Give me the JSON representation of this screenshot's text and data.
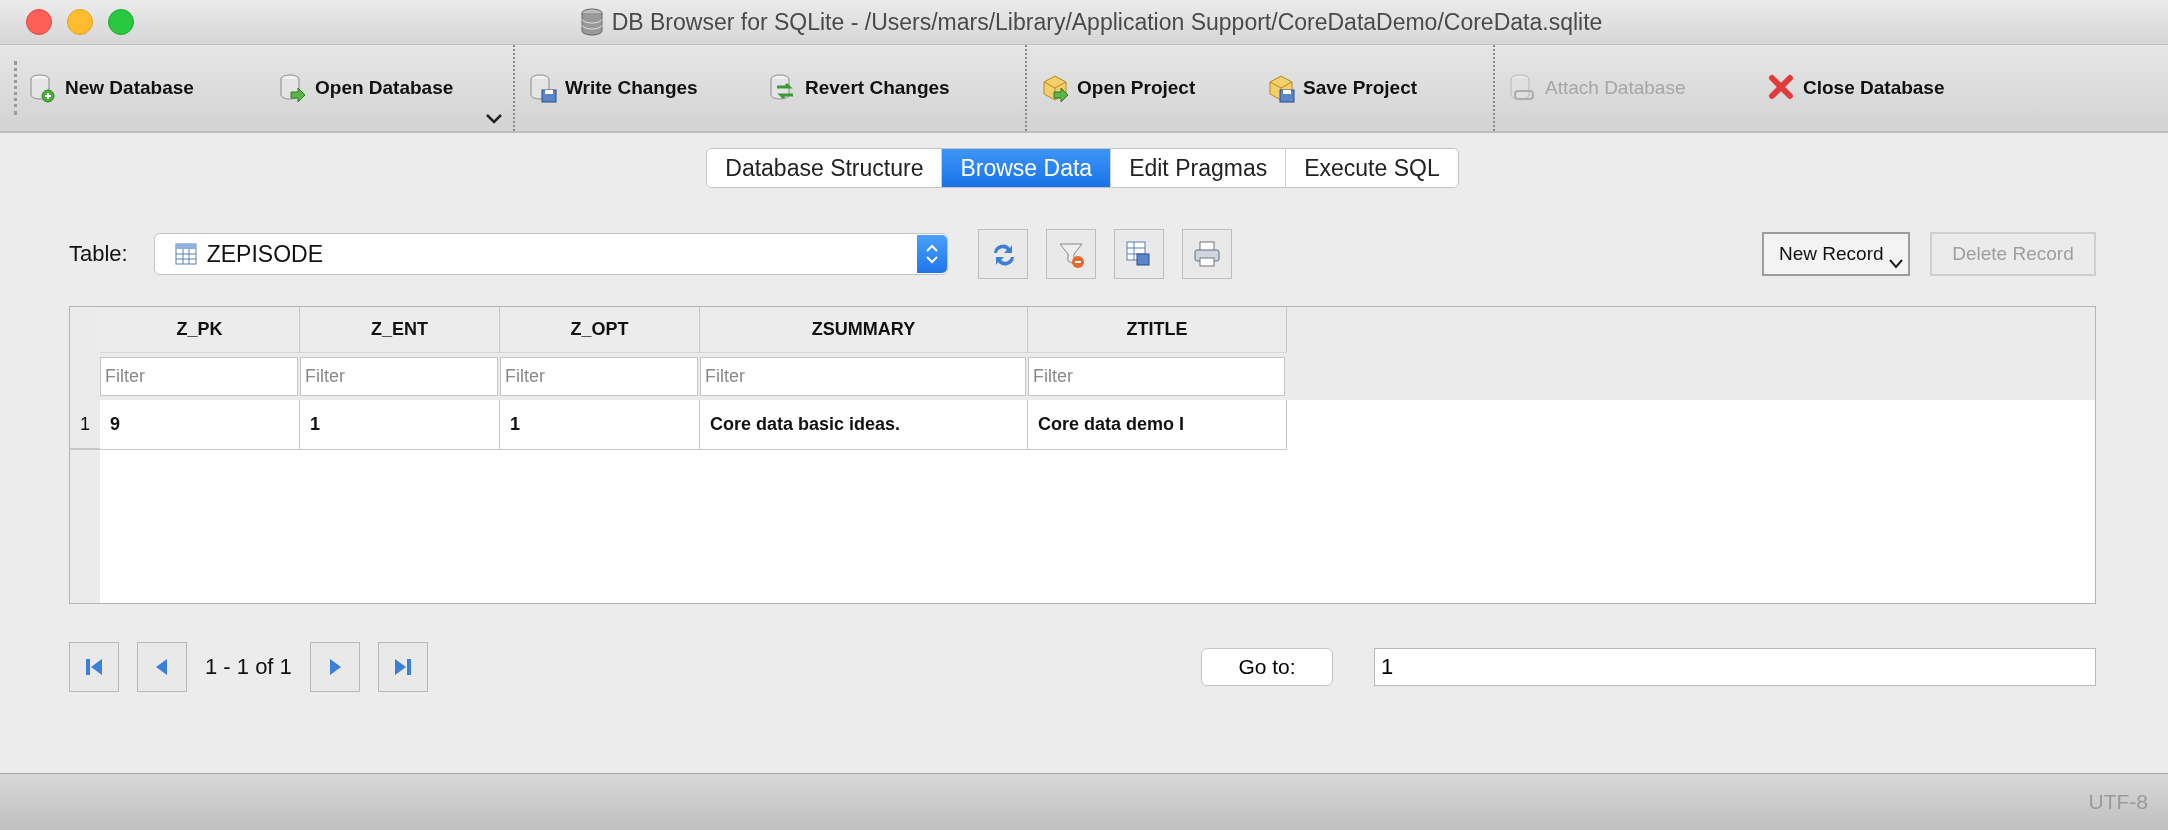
{
  "window": {
    "title": "DB Browser for SQLite - /Users/mars/Library/Application Support/CoreDataDemo/CoreData.sqlite"
  },
  "toolbar": {
    "items": [
      {
        "kind": "button",
        "label": "New Database",
        "disabled": false
      },
      {
        "kind": "button",
        "label": "Open Database",
        "disabled": false
      },
      {
        "kind": "separator"
      },
      {
        "kind": "button",
        "label": "Write Changes",
        "disabled": false
      },
      {
        "kind": "button",
        "label": "Revert Changes",
        "disabled": false
      },
      {
        "kind": "separator"
      },
      {
        "kind": "button",
        "label": "Open Project",
        "disabled": false
      },
      {
        "kind": "button",
        "label": "Save Project",
        "disabled": false
      },
      {
        "kind": "separator"
      },
      {
        "kind": "button",
        "label": "Attach Database",
        "disabled": true
      },
      {
        "kind": "button",
        "label": "Close Database",
        "disabled": false
      }
    ]
  },
  "tabs": [
    {
      "label": "Database Structure",
      "selected": false
    },
    {
      "label": "Browse Data",
      "selected": true
    },
    {
      "label": "Edit Pragmas",
      "selected": false
    },
    {
      "label": "Execute SQL",
      "selected": false
    }
  ],
  "table_selector": {
    "label": "Table:",
    "value": "ZEPISODE"
  },
  "record_buttons": [
    {
      "label": "New Record",
      "disabled": false
    },
    {
      "label": "Delete Record",
      "disabled": true
    }
  ],
  "grid": {
    "columns": [
      {
        "name": "Z_PK",
        "filter_placeholder": "Filter"
      },
      {
        "name": "Z_ENT",
        "filter_placeholder": "Filter"
      },
      {
        "name": "Z_OPT",
        "filter_placeholder": "Filter"
      },
      {
        "name": "ZSUMMARY",
        "filter_placeholder": "Filter"
      },
      {
        "name": "ZTITLE",
        "filter_placeholder": "Filter"
      }
    ],
    "rows": [
      {
        "number": "1",
        "cells": [
          "9",
          "1",
          "1",
          "Core data basic ideas.",
          "Core data demo I"
        ]
      }
    ]
  },
  "pagination": {
    "range": "1 - 1 of 1",
    "goto_label": "Go to:",
    "goto_value": "1"
  },
  "status_bar": {
    "encoding": "UTF-8"
  }
}
